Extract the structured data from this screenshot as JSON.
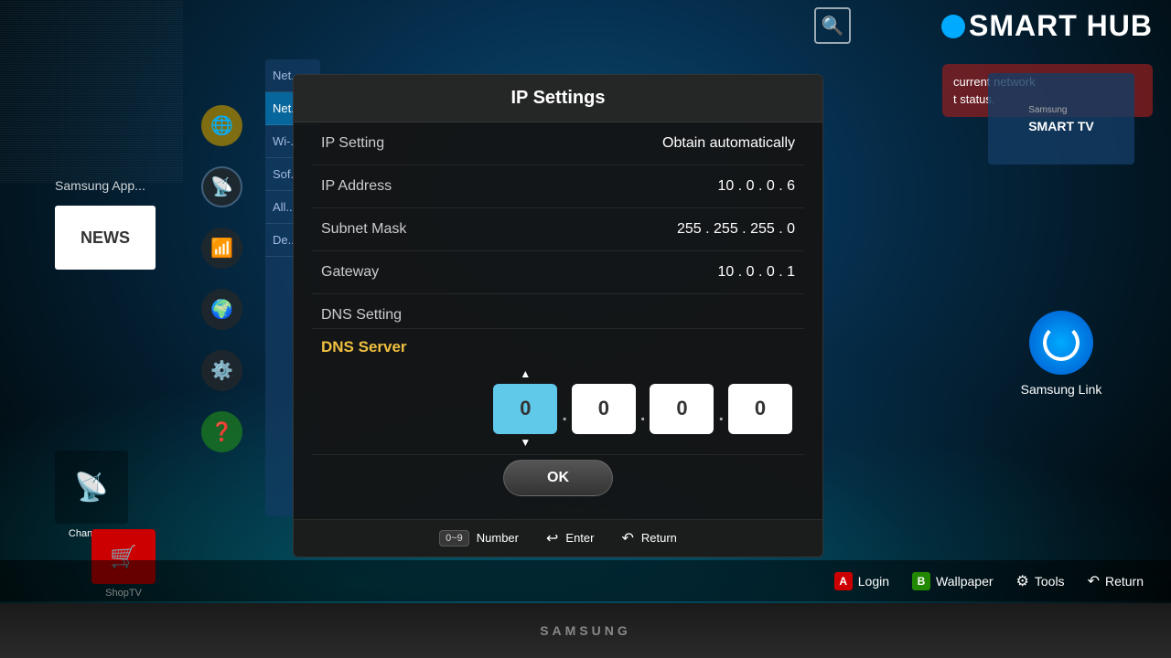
{
  "tv": {
    "brand": "SAMSUNG",
    "smart_hub_title": "SMART HUB"
  },
  "sidebar": {
    "items": [
      {
        "label": "Net...",
        "active": false
      },
      {
        "label": "Net...",
        "active": true
      },
      {
        "label": "Wi-...",
        "active": false
      },
      {
        "label": "Sof...",
        "active": false
      },
      {
        "label": "All...",
        "active": false
      },
      {
        "label": "De...",
        "active": false
      }
    ]
  },
  "right_panel": {
    "text1": "current network",
    "text2": "t status."
  },
  "dialog": {
    "title": "IP Settings",
    "rows": [
      {
        "label": "IP Setting",
        "value": "Obtain automatically"
      },
      {
        "label": "IP Address",
        "value": "10 . 0 . 0 . 6"
      },
      {
        "label": "Subnet Mask",
        "value": "255 . 255 . 255 . 0"
      },
      {
        "label": "Gateway",
        "value": "10 . 0 . 0 . 1"
      },
      {
        "label": "DNS Setting",
        "value": ""
      }
    ],
    "dns_server_label": "DNS Server",
    "dns_values": [
      "0",
      "0",
      "0",
      "0"
    ],
    "ok_button": "OK",
    "footer": [
      {
        "key": "0~9",
        "label": "Number"
      },
      {
        "icon": "↩",
        "label": "Enter"
      },
      {
        "icon": "↶",
        "label": "Return"
      }
    ]
  },
  "bottom_toolbar": {
    "login_label": "Login",
    "wallpaper_label": "Wallpaper",
    "tools_label": "Tools",
    "return_label": "Return"
  },
  "samsung_link": {
    "label": "Samsung Link"
  },
  "apps": {
    "channel_label": "Channel...",
    "shoptv_label": "ShopTV",
    "samsung_apps_label": "Samsung App..."
  }
}
